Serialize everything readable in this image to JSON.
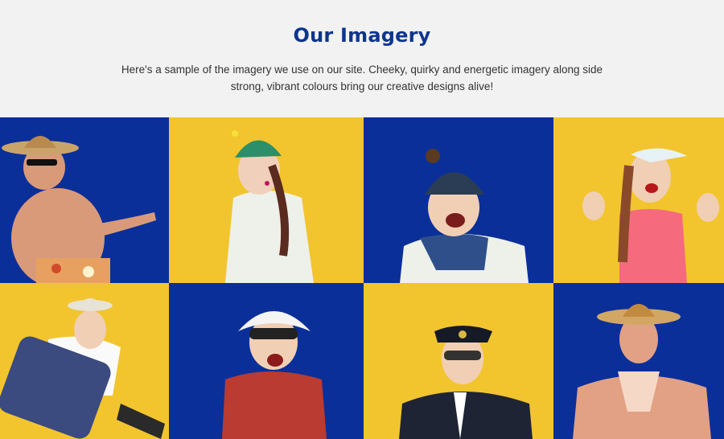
{
  "section": {
    "title": "Our Imagery",
    "description": "Here's a sample of the imagery we use on our site. Cheeky, quirky and energetic imagery along side strong, vibrant colours bring our creative designs alive!"
  },
  "colors": {
    "brand_blue": "#0d3590",
    "tile_blue": "#0a2f99",
    "tile_yellow": "#f2c52e",
    "background": "#f2f2f2"
  },
  "tiles": [
    {
      "name": "man-sombrero-sunglasses",
      "bg": "tile_blue"
    },
    {
      "name": "woman-christmas-beanie",
      "bg": "tile_yellow"
    },
    {
      "name": "man-bobble-hat-scarf",
      "bg": "tile_blue"
    },
    {
      "name": "woman-visor-pink-top",
      "bg": "tile_yellow"
    },
    {
      "name": "man-suitcase-fedora",
      "bg": "tile_yellow"
    },
    {
      "name": "woman-sunhat-sunglasses",
      "bg": "tile_blue"
    },
    {
      "name": "pilot-aviators",
      "bg": "tile_yellow"
    },
    {
      "name": "man-sombrero-sunburn",
      "bg": "tile_blue"
    }
  ]
}
